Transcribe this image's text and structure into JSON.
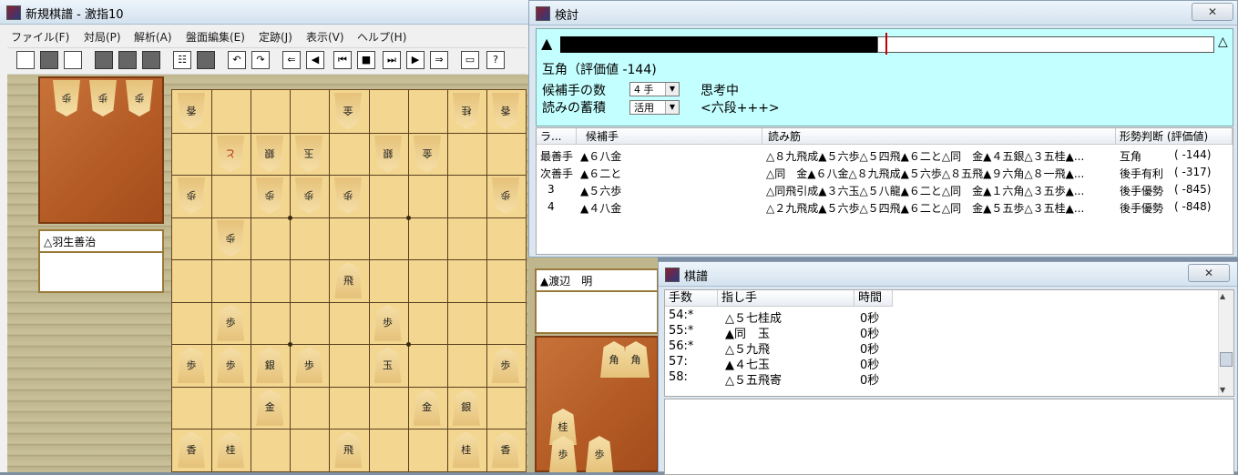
{
  "main": {
    "title": "新規棋譜 - 激指10",
    "menu": [
      "ファイル(F)",
      "対局(P)",
      "解析(A)",
      "盤面編集(E)",
      "定跡(J)",
      "表示(V)",
      "ヘルプ(H)"
    ],
    "gote_player": "△羽生善治",
    "gote_hand": [
      "歩",
      "歩",
      "歩"
    ],
    "board": [
      [
        "香",
        "",
        "",
        "",
        "金",
        "",
        "",
        "桂",
        "香"
      ],
      [
        "",
        "と",
        "銀",
        "玉",
        "",
        "銀",
        "金",
        "",
        ""
      ],
      [
        "歩",
        "",
        "歩",
        "歩",
        "歩",
        "",
        "",
        "",
        "歩"
      ],
      [
        "",
        "歩",
        "",
        "",
        "",
        "",
        "",
        "",
        ""
      ],
      [
        "",
        "",
        "",
        "",
        "飛",
        "",
        "",
        "",
        ""
      ],
      [
        "",
        "歩",
        "",
        "",
        "",
        "歩",
        "",
        "",
        ""
      ],
      [
        "歩",
        "歩",
        "銀",
        "歩",
        "",
        "玉",
        "",
        "",
        "歩"
      ],
      [
        "",
        "",
        "金",
        "",
        "",
        "",
        "金",
        "銀",
        ""
      ],
      [
        "香",
        "桂",
        "",
        "",
        "飛",
        "",
        "",
        "桂",
        "香"
      ]
    ]
  },
  "analysis": {
    "title": "検討",
    "close": "✕",
    "black_mark": "▲",
    "white_mark": "△",
    "eval_text": "互角（評価値 -144)",
    "candidates_label": "候補手の数",
    "candidates_value": "4 手",
    "reading_label": "読みの蓄積",
    "reading_value": "活用",
    "status": "思考中",
    "engine": "<六段+++>",
    "headers": [
      "ラ...",
      "候補手",
      "読み筋",
      "形勢判断 (評価値)"
    ],
    "rows": [
      {
        "rank": "最善手",
        "move": "▲６八金",
        "line": "△８九飛成▲５六歩△５四飛▲６二と△同　金▲４五銀△３五桂▲...",
        "judge": "互角",
        "value": "(   -144)"
      },
      {
        "rank": "次善手",
        "move": "▲６二と",
        "line": "△同　金▲６八金△８九飛成▲５六歩△８五飛▲９六角△８一飛▲...",
        "judge": "後手有利",
        "value": "(   -317)"
      },
      {
        "rank": "3",
        "move": "▲５六歩",
        "line": "△同飛引成▲３六玉△５八龍▲６二と△同　金▲１六角△３五歩▲...",
        "judge": "後手優勢",
        "value": "(   -845)"
      },
      {
        "rank": "4",
        "move": "▲４八金",
        "line": "△２九飛成▲５六歩△５四飛▲６二と△同　金▲５五歩△３五桂▲...",
        "judge": "後手優勢",
        "value": "(   -848)"
      }
    ]
  },
  "kifu": {
    "title": "棋譜",
    "close": "✕",
    "headers": [
      "手数",
      "指し手",
      "時間"
    ],
    "moves": [
      {
        "n": "54:*",
        "move": "△５七桂成",
        "time": "0秒"
      },
      {
        "n": "55:*",
        "move": "▲同　玉",
        "time": "0秒"
      },
      {
        "n": "56:*",
        "move": "△５九飛",
        "time": "0秒"
      },
      {
        "n": "57:",
        "move": "▲４七玉",
        "time": "0秒"
      },
      {
        "n": "58:",
        "move": "△５五飛寄",
        "time": "0秒"
      }
    ]
  },
  "sente": {
    "player": "▲渡辺　明",
    "hand": [
      "角",
      "角",
      "桂",
      "歩",
      "歩"
    ]
  }
}
